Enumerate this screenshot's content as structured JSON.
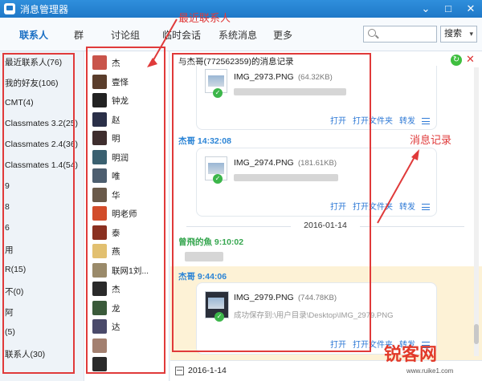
{
  "window": {
    "title": "消息管理器",
    "minimize": "⌄",
    "maximize": "□",
    "close": "✕"
  },
  "tabs": [
    {
      "label": "联系人",
      "active": true
    },
    {
      "label": "群"
    },
    {
      "label": "讨论组"
    },
    {
      "label": "临时会话"
    },
    {
      "label": "系统消息"
    },
    {
      "label": "更多"
    }
  ],
  "search": {
    "placeholder": "",
    "button_label": "搜索"
  },
  "annotations": {
    "recent_contacts": "最近联系人",
    "message_history": "消息记录"
  },
  "groups": [
    "最近联系人(76)",
    "我的好友(106)",
    "CMT(4)",
    "Classmates 3.2(25)",
    "Classmates 2.4(36)",
    "Classmates 1.4(54)",
    "9",
    "8",
    "6",
    "用",
    "R(15)",
    "不(0)",
    "阿",
    "(5)",
    "联系人(30)"
  ],
  "contacts": [
    {
      "name": "杰",
      "color": "#c9544a"
    },
    {
      "name": "壹怿",
      "color": "#5a3d2b"
    },
    {
      "name": "钟龙",
      "color": "#222222"
    },
    {
      "name": "赵",
      "color": "#2a2f48"
    },
    {
      "name": "明",
      "color": "#3e2d2d"
    },
    {
      "name": "明润",
      "color": "#3a6070"
    },
    {
      "name": "唯",
      "color": "#4d5e6f"
    },
    {
      "name": "华",
      "color": "#6a5a4a"
    },
    {
      "name": "明老师",
      "color": "#d24c2a"
    },
    {
      "name": "泰",
      "color": "#8a3020"
    },
    {
      "name": "燕",
      "color": "#e2c070"
    },
    {
      "name": "联网1刘...",
      "color": "#9a8a6a"
    },
    {
      "name": "杰",
      "color": "#2a2a2a"
    },
    {
      "name": "龙",
      "color": "#3a5a3a"
    },
    {
      "name": "达",
      "color": "#4a4a6a"
    },
    {
      "name": "",
      "color": "#a38070"
    },
    {
      "name": "",
      "color": "#2a2a2a"
    }
  ],
  "chat": {
    "title": "与杰哥(772562359)的消息记录",
    "back_icon": "refresh-icon",
    "messages": [
      {
        "file_name": "IMG_2973.PNG",
        "file_size": "(64.32KB)",
        "actions": [
          "打开",
          "打开文件夹",
          "转发"
        ]
      },
      {
        "sender": "杰哥 14:32:08",
        "file_name": "IMG_2974.PNG",
        "file_size": "(181.61KB)",
        "actions": [
          "打开",
          "打开文件夹",
          "转发"
        ]
      },
      {
        "date": "2016-01-14"
      },
      {
        "sender": "曾飛的魚 9:10:02"
      },
      {
        "sender": "杰哥 9:44:06",
        "file_name": "IMG_2979.PNG",
        "file_size": "(744.78KB)",
        "status": "成功保存到:\\用户目录\\Desktop\\IMG_2979.PNG",
        "actions": [
          "打开",
          "打开文件夹",
          "转发"
        ]
      }
    ],
    "footer_date": "2016-1-14"
  },
  "watermark": {
    "main": "锐客网",
    "sub": "www.ruike1.com"
  },
  "colors": {
    "accent": "#1f78c8",
    "annotation": "#e03a3a",
    "link": "#2f7ad6",
    "highlight": "#fdf2d6"
  }
}
